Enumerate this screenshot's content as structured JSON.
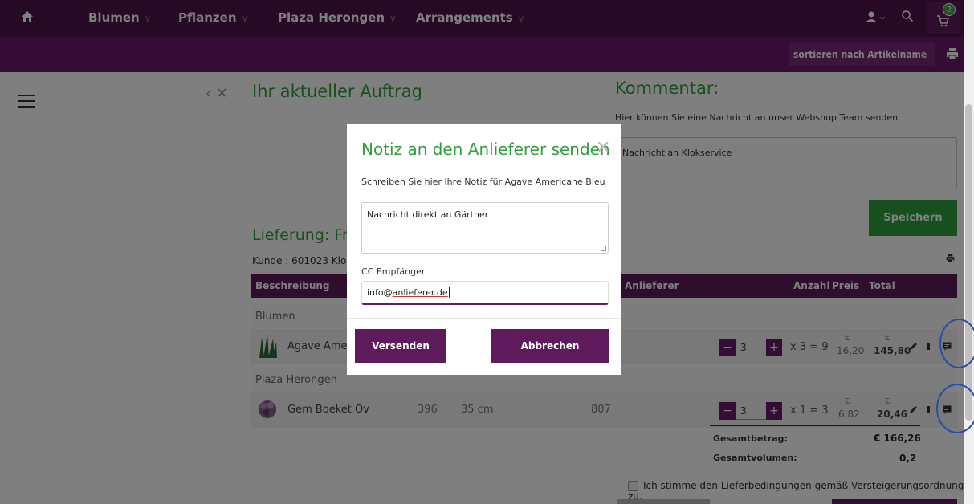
{
  "nav": {
    "items": [
      {
        "label": "Blumen"
      },
      {
        "label": "Pflanzen"
      },
      {
        "label": "Plaza Herongen"
      },
      {
        "label": "Arrangements"
      }
    ],
    "cart_count": "2"
  },
  "sortbar": {
    "sort_label": "sortieren nach Artikelname"
  },
  "order": {
    "heading": "Ihr aktueller Auftrag",
    "delivery_heading": "Lieferung: Fr",
    "customer": "Kunde : 601023 Klo"
  },
  "comment": {
    "heading": "Kommentar:",
    "hint": "Hier können Sie eine Nachricht an unser Webshop Team senden.",
    "value": "Nachricht an Klokservice",
    "save_label": "Speichern"
  },
  "table": {
    "headers": {
      "description": "Beschreibung",
      "supplier": "Anlieferer",
      "quantity": "Anzahl",
      "price": "Preis",
      "total": "Total"
    },
    "groups": [
      {
        "name": "Blumen",
        "items": [
          {
            "name": "Agave Americ",
            "col1": "",
            "col2": "",
            "supplier": "",
            "qty": "3",
            "mult": "x 3 = 9",
            "currency": "€",
            "price": "16,20",
            "total_currency": "€",
            "total": "145,80"
          }
        ]
      },
      {
        "name": "Plaza Herongen",
        "items": [
          {
            "name": "Gem Boeket Ov",
            "col1": "396",
            "col2": "35 cm",
            "supplier": "807",
            "qty": "3",
            "mult": "x 1 = 3",
            "currency": "€",
            "price": "6,82",
            "total_currency": "€",
            "total": "20,46"
          }
        ]
      }
    ]
  },
  "summary": {
    "total_label": "Gesamtbetrag:",
    "total_value": "€ 166,26",
    "volume_label": "Gesamtvolumen:",
    "volume_value": "0,2"
  },
  "terms": {
    "label": "Ich stimme den Lieferbedingungen gemäß Versteigerungsordnung zu."
  },
  "modal": {
    "title": "Notiz an den Anlieferer senden",
    "subtitle": "Schreiben Sie hier Ihre Notiz für Agave Americane Bleu",
    "note_value": "Nachricht direkt an Gärtner",
    "cc_label": "CC Empfänger",
    "cc_value_prefix": "info@",
    "cc_value_underlined": "anlieferer.de",
    "send_label": "Versenden",
    "cancel_label": "Abbrechen"
  },
  "colors": {
    "brand_purple": "#6a1b68",
    "accent_green": "#2f9e3f"
  }
}
